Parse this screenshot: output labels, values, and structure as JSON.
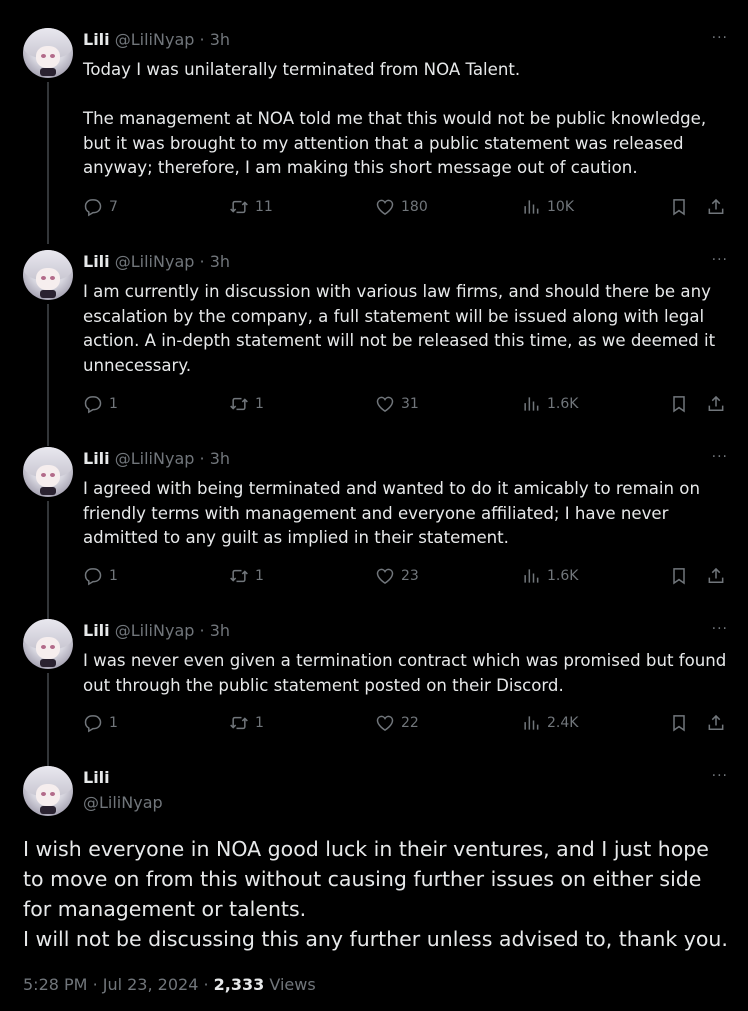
{
  "tweets": [
    {
      "name": "Lili",
      "handle": "@LiliNyap",
      "time": "3h",
      "more": "···",
      "text": [
        "Today I was unilaterally terminated from NOA Talent.",
        "The management at NOA told me that this would not be public knowledge, but it was brought to my attention that a public statement was released anyway; therefore, I am making this short message out of caution."
      ],
      "replies": "7",
      "reposts": "11",
      "likes": "180",
      "views": "10K"
    },
    {
      "name": "Lili",
      "handle": "@LiliNyap",
      "time": "3h",
      "more": "···",
      "text": [
        "I am currently in discussion with various law firms, and should there be any escalation by the company, a full statement will be issued along with legal action. A in-depth statement will not be released this time, as we deemed it unnecessary."
      ],
      "replies": "1",
      "reposts": "1",
      "likes": "31",
      "views": "1.6K"
    },
    {
      "name": "Lili",
      "handle": "@LiliNyap",
      "time": "3h",
      "more": "···",
      "text": [
        "I agreed with being terminated and wanted to do it amicably to remain on friendly terms with management and everyone affiliated; I have never admitted to any guilt as implied in their statement."
      ],
      "replies": "1",
      "reposts": "1",
      "likes": "23",
      "views": "1.6K"
    },
    {
      "name": "Lili",
      "handle": "@LiliNyap",
      "time": "3h",
      "more": "···",
      "text": [
        "I was never even given a termination contract which was promised but found out through the public statement posted on their Discord."
      ],
      "replies": "1",
      "reposts": "1",
      "likes": "22",
      "views": "2.4K"
    }
  ],
  "main_tweet": {
    "name": "Lili",
    "handle": "@LiliNyap",
    "more": "···",
    "text": [
      "I wish everyone in NOA good luck in their ventures, and I just hope to move on from this without causing further issues on either side for management or talents.",
      "I will not be discussing this any further unless advised to, thank you."
    ],
    "time": "5:28 PM",
    "date": "Jul 23, 2024",
    "views_count": "2,333",
    "views_label": "Views"
  },
  "colors": {
    "background": "#000000",
    "text": "#e7e9ea",
    "muted": "#71767b",
    "thread_line": "#333639"
  },
  "icons": [
    "reply-icon",
    "repost-icon",
    "like-icon",
    "views-icon",
    "bookmark-icon",
    "share-icon",
    "more-icon"
  ]
}
